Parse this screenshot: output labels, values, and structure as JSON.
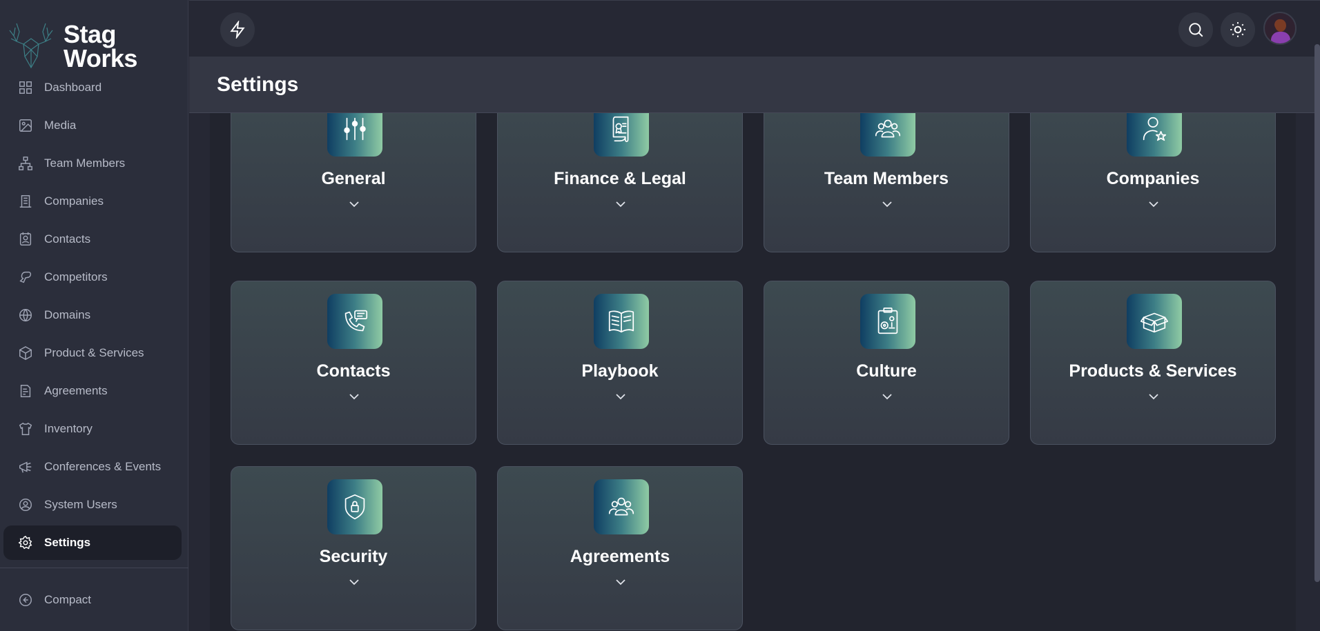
{
  "app": {
    "logo_text": "Stag\nWorks"
  },
  "sidebar": {
    "items": [
      {
        "label": "Dashboard",
        "icon": "dashboard-icon"
      },
      {
        "label": "Media",
        "icon": "image-icon"
      },
      {
        "label": "Team Members",
        "icon": "org-chart-icon"
      },
      {
        "label": "Companies",
        "icon": "building-icon"
      },
      {
        "label": "Contacts",
        "icon": "contact-card-icon"
      },
      {
        "label": "Competitors",
        "icon": "boxing-glove-icon"
      },
      {
        "label": "Domains",
        "icon": "globe-icon"
      },
      {
        "label": "Product & Services",
        "icon": "box-icon"
      },
      {
        "label": "Agreements",
        "icon": "document-edit-icon"
      },
      {
        "label": "Inventory",
        "icon": "tshirt-icon"
      },
      {
        "label": "Conferences & Events",
        "icon": "megaphone-icon"
      },
      {
        "label": "System Users",
        "icon": "user-circle-icon"
      },
      {
        "label": "Settings",
        "icon": "gear-icon",
        "active": true
      }
    ],
    "compact_label": "Compact"
  },
  "header": {
    "page_title": "Settings"
  },
  "cards": [
    {
      "title": "General",
      "icon": "sliders-icon"
    },
    {
      "title": "Finance & Legal",
      "icon": "certificate-scroll-icon"
    },
    {
      "title": "Team Members",
      "icon": "users-group-icon"
    },
    {
      "title": "Companies",
      "icon": "user-star-icon"
    },
    {
      "title": "Contacts",
      "icon": "phone-message-icon"
    },
    {
      "title": "Playbook",
      "icon": "open-book-icon"
    },
    {
      "title": "Culture",
      "icon": "clipboard-gears-icon"
    },
    {
      "title": "Products & Services",
      "icon": "open-box-icon"
    },
    {
      "title": "Security",
      "icon": "shield-lock-icon"
    },
    {
      "title": "Agreements",
      "icon": "users-group-icon"
    }
  ],
  "colors": {
    "background": "#262834",
    "sidebar": "#2b2e3b",
    "content": "#22242e",
    "card_gradient_start": "#0f3e62",
    "card_gradient_end": "#8fcba4"
  }
}
